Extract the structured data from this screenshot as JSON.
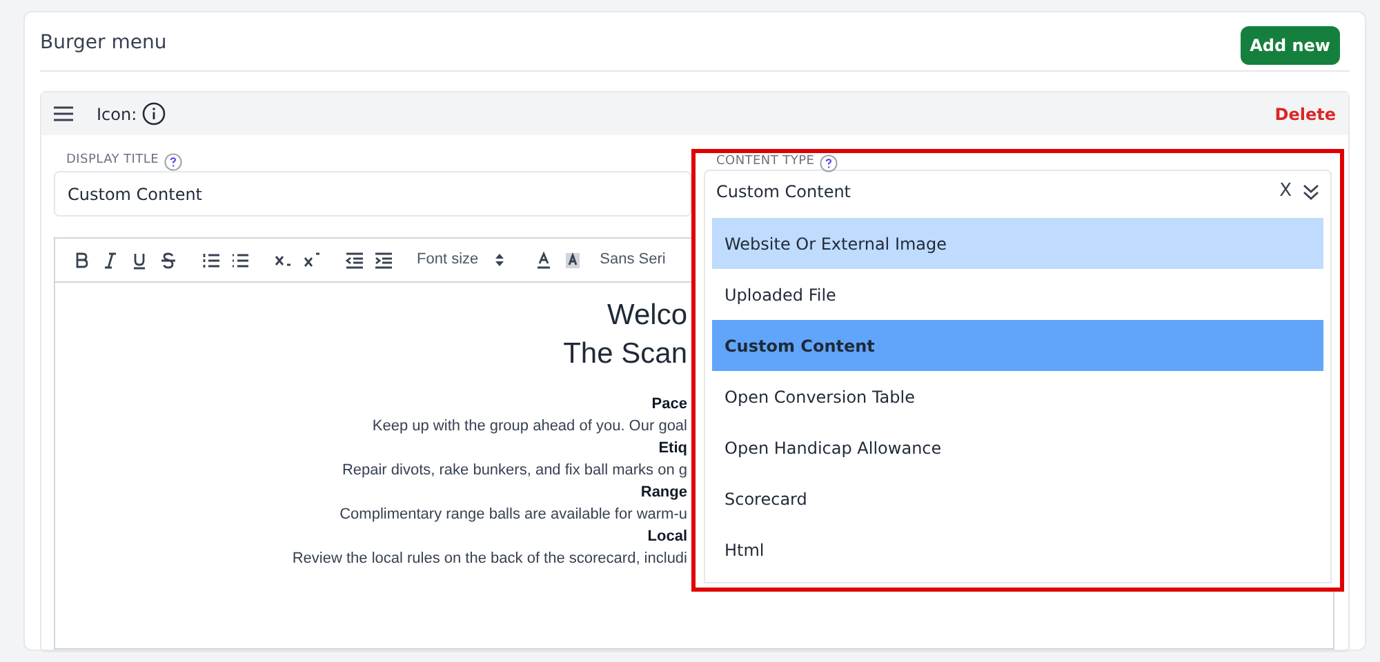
{
  "card": {
    "title": "Burger menu",
    "add_button": "Add new"
  },
  "item": {
    "icon_label": "Icon:",
    "delete": "Delete",
    "display_title": {
      "label": "DISPLAY TITLE",
      "value": "Custom Content"
    },
    "toolbar": {
      "font_size": "Font size",
      "font_family": "Sans Seri"
    },
    "editor_lines": [
      {
        "kind": "heading",
        "text": "Welco"
      },
      {
        "kind": "heading",
        "text": "The Scan"
      },
      {
        "kind": "spacer"
      },
      {
        "kind": "bold",
        "text": "Pace"
      },
      {
        "kind": "plain",
        "text": "Keep up with the group ahead of you. Our goal"
      },
      {
        "kind": "bold",
        "text": "Etiq"
      },
      {
        "kind": "plain",
        "text": "Repair divots, rake bunkers, and fix ball marks on g"
      },
      {
        "kind": "bold",
        "text": "Range"
      },
      {
        "kind": "plain",
        "text": "Complimentary range balls are available for warm-u"
      },
      {
        "kind": "bold",
        "text": "Local"
      },
      {
        "kind": "plain",
        "text": "Review the local rules on the back of the scorecard, includi"
      }
    ],
    "content_type": {
      "label": "CONTENT TYPE",
      "value": "Custom Content",
      "clear": "X",
      "highlighted": true,
      "options": [
        {
          "label": "Website Or External Image",
          "selected": false,
          "hovered": true
        },
        {
          "label": "Uploaded File",
          "selected": false,
          "hovered": false
        },
        {
          "label": "Custom Content",
          "selected": true,
          "hovered": false
        },
        {
          "label": "Open Conversion Table",
          "selected": false,
          "hovered": false
        },
        {
          "label": "Open Handicap Allowance",
          "selected": false,
          "hovered": false
        },
        {
          "label": "Scorecard",
          "selected": false,
          "hovered": false
        },
        {
          "label": "Html",
          "selected": false,
          "hovered": false
        }
      ]
    }
  }
}
